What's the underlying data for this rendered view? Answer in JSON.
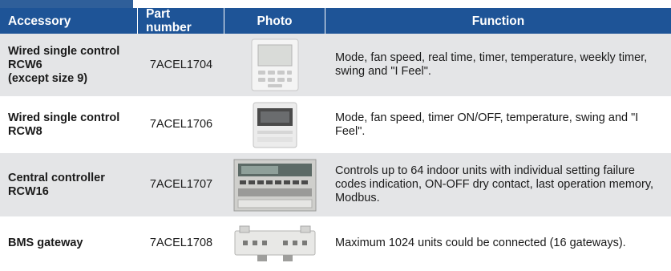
{
  "table": {
    "headers": [
      "Accessory",
      "Part number",
      "Photo",
      "Function"
    ],
    "rows": [
      {
        "accessory": "Wired single control\nRCW6\n(except size 9)",
        "part_number": "7ACEL1704",
        "photo_icon": "wired-control-rcw6-photo",
        "function": "Mode, fan speed, real time, timer, temperature, weekly timer, swing and \"I Feel\"."
      },
      {
        "accessory": "Wired single control\nRCW8",
        "part_number": "7ACEL1706",
        "photo_icon": "wired-control-rcw8-photo",
        "function": "Mode, fan speed, timer ON/OFF, temperature, swing and \"I Feel\"."
      },
      {
        "accessory": "Central controller\nRCW16",
        "part_number": "7ACEL1707",
        "photo_icon": "central-controller-photo",
        "function": "Controls up to 64 indoor units with individual setting failure codes indication, ON-OFF dry contact, last operation memory, Modbus."
      },
      {
        "accessory": "BMS gateway",
        "part_number": "7ACEL1708",
        "photo_icon": "bms-gateway-photo",
        "function": "Maximum 1024 units could be connected (16 gateways)."
      }
    ]
  },
  "colors": {
    "header_bg": "#1e5497",
    "row_shade": "#e4e5e7",
    "tab": "#2f5f9a"
  }
}
